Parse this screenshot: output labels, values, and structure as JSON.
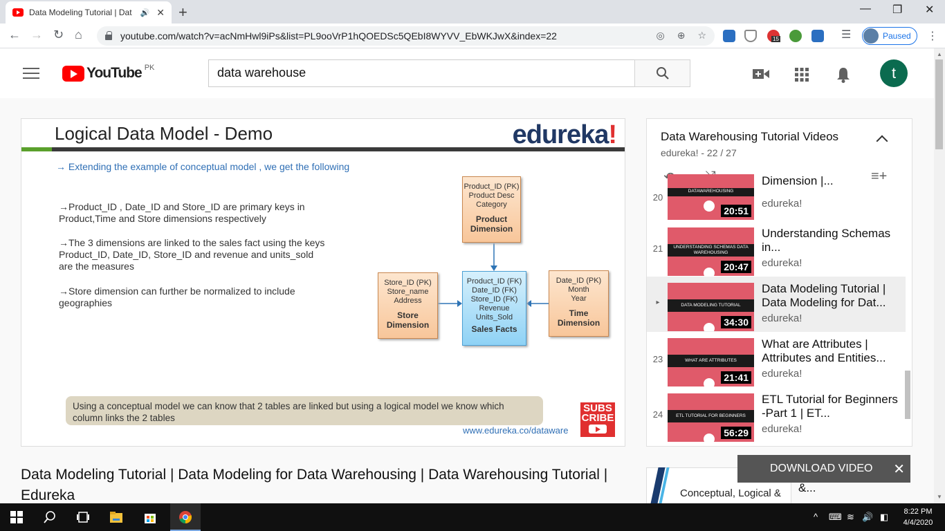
{
  "browser": {
    "tab_title": "Data Modeling Tutorial | Dat",
    "url": "youtube.com/watch?v=acNmHwl9iPs&list=PL9ooVrP1hQOEDSc5QEbI8WYVV_EbWKJwX&index=22",
    "profile_status": "Paused",
    "badge_count": "15"
  },
  "youtube": {
    "logo_text": "YouTube",
    "country_code": "PK",
    "search_value": "data warehouse",
    "avatar_letter": "t"
  },
  "slide": {
    "title": "Logical Data Model - Demo",
    "logo": "edureka",
    "subtitle": "→ Extending the example of conceptual model , we get the following",
    "bullets": [
      "→Product_ID , Date_ID and Store_ID are primary keys in Product,Time and Store dimensions respectively",
      "→The 3 dimensions are linked to the sales fact using the keys Product_ID, Date_ID, Store_ID and revenue and units_sold are the measures",
      "→Store dimension can further be normalized to include geographies"
    ],
    "boxes": {
      "product": {
        "lines": [
          "Product_ID (PK)",
          "Product Desc",
          "Category"
        ],
        "name": "Product Dimension"
      },
      "store": {
        "lines": [
          "Store_ID (PK)",
          "Store_name",
          "Address"
        ],
        "name": "Store Dimension"
      },
      "sales": {
        "lines": [
          "Product_ID (FK)",
          "Date_ID (FK)",
          "Store_ID (FK)",
          "Revenue",
          "Units_Sold"
        ],
        "name": "Sales Facts"
      },
      "time": {
        "lines": [
          "Date_ID (PK)",
          "Month",
          "Year"
        ],
        "name": "Time Dimension"
      }
    },
    "caption": "Using a conceptual model we can know that 2 tables are linked but using a logical model we know which column links the 2 tables",
    "subscribe": "SUBS CRIBE",
    "url": "www.edureka.co/dataware"
  },
  "video_title": "Data Modeling Tutorial | Data Modeling for Data Warehousing | Data Warehousing Tutorial | Edureka",
  "playlist": {
    "title": "Data Warehousing Tutorial Videos",
    "meta": "edureka! - 22 / 27",
    "items": [
      {
        "index": "20",
        "name": "Dimension |...",
        "channel": "edureka!",
        "duration": "20:51",
        "thumb_text": "DATAWAREHOUSING"
      },
      {
        "index": "21",
        "name": "Understanding Schemas in...",
        "channel": "edureka!",
        "duration": "20:47",
        "thumb_text": "UNDERSTANDING SCHEMAS DATA WAREHOUSING"
      },
      {
        "index": "▸",
        "name": "Data Modeling Tutorial | Data Modeling for Dat...",
        "channel": "edureka!",
        "duration": "34:30",
        "thumb_text": "DATA MODELING TUTORIAL"
      },
      {
        "index": "23",
        "name": "What are Attributes | Attributes and Entities...",
        "channel": "edureka!",
        "duration": "21:41",
        "thumb_text": "WHAT ARE ATTRIBUTES"
      },
      {
        "index": "24",
        "name": "ETL Tutorial for Beginners -Part 1 | ET...",
        "channel": "edureka!",
        "duration": "56:29",
        "thumb_text": "ETL TUTORIAL FOR BEGINNERS"
      }
    ]
  },
  "next_video": {
    "thumb_text": "Conceptual, Logical &",
    "title": "Conceptual, Logical &..."
  },
  "download_bar": {
    "label": "DOWNLOAD VIDEO"
  },
  "taskbar": {
    "time": "8:22 PM",
    "date": "4/4/2020"
  }
}
